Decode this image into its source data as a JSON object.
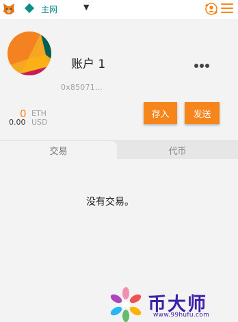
{
  "network": {
    "label": "主网",
    "caret": "▼"
  },
  "account": {
    "name": "账户 1",
    "address": "0x85071...",
    "balance_eth": "0",
    "eth_unit": "ETH",
    "balance_usd": "0.00",
    "usd_unit": "USD"
  },
  "actions": {
    "deposit": "存入",
    "send": "发送"
  },
  "tabs": {
    "transactions": "交易",
    "tokens": "代币"
  },
  "empty": {
    "message": "没有交易。"
  },
  "watermark": {
    "title": "币大师",
    "url": "www.99hufu.com"
  },
  "colors": {
    "accent": "#f6851b",
    "network": "#0f8c8c",
    "watermark": "#3a1fa8"
  },
  "icons": [
    "metamask-fox-icon",
    "network-diamond-icon",
    "account-switch-icon",
    "hamburger-menu-icon",
    "more-dots-icon"
  ]
}
